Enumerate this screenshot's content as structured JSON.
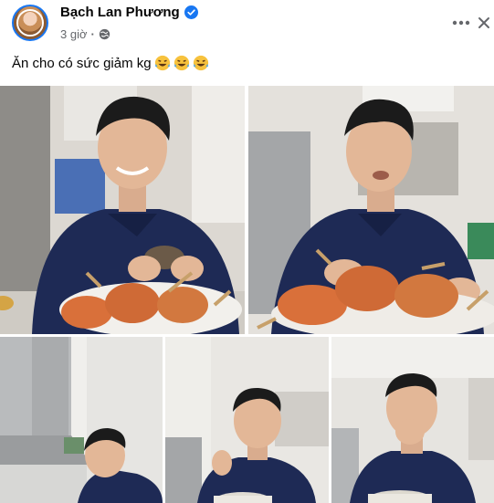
{
  "post": {
    "author": "Bạch Lan Phương",
    "time": "3 giờ",
    "separator": "·",
    "caption": "Ăn cho có sức giảm kg",
    "emojis": [
      "laughing-tears",
      "laughing-tears",
      "laughing-tears"
    ]
  },
  "colors": {
    "accent": "#1877f2",
    "secondary_text": "#65676b",
    "hoodie": "#1e2a55",
    "crab": "#d9703a"
  },
  "icons": [
    "verified-badge-icon",
    "globe-icon",
    "more-options-icon",
    "close-icon"
  ],
  "photos": [
    {
      "subject": "man smiling holding a crab over a plate of crabs"
    },
    {
      "subject": "man chewing behind a plate of crabs"
    },
    {
      "subject": "kitchen range hood, man looking down"
    },
    {
      "subject": "man eating from a bowl"
    },
    {
      "subject": "man eating with hand over mouth"
    }
  ]
}
